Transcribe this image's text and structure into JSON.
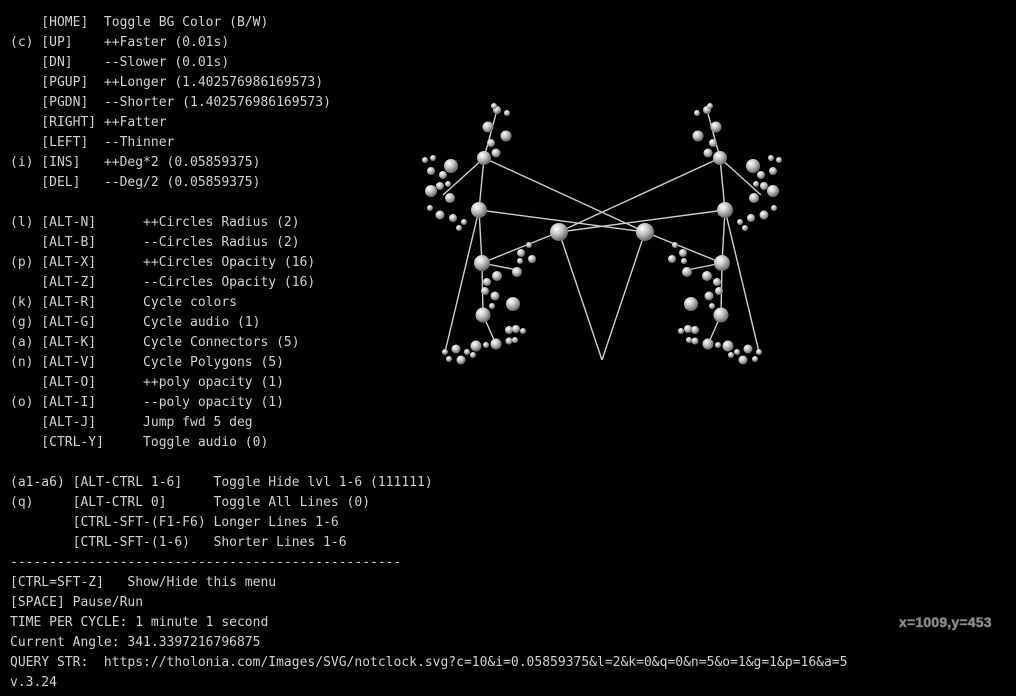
{
  "menu": {
    "lines": [
      "    [HOME]  Toggle BG Color (B/W)",
      "(c) [UP]    ++Faster (0.01s)",
      "    [DN]    --Slower (0.01s)",
      "    [PGUP]  ++Longer (1.402576986169573)",
      "    [PGDN]  --Shorter (1.402576986169573)",
      "    [RIGHT] ++Fatter",
      "    [LEFT]  --Thinner",
      "(i) [INS]   ++Deg*2 (0.05859375)",
      "    [DEL]   --Deg/2 (0.05859375)",
      "",
      "(l) [ALT-N]      ++Circles Radius (2)",
      "    [ALT-B]      --Circles Radius (2)",
      "(p) [ALT-X]      ++Circles Opacity (16)",
      "    [ALT-Z]      --Circles Opacity (16)",
      "(k) [ALT-R]      Cycle colors",
      "(g) [ALT-G]      Cycle audio (1)",
      "(a) [ALT-K]      Cycle Connectors (5)",
      "(n) [ALT-V]      Cycle Polygons (5)",
      "    [ALT-O]      ++poly opacity (1)",
      "(o) [ALT-I]      --poly opacity (1)",
      "    [ALT-J]      Jump fwd 5 deg",
      "    [CTRL-Y]     Toggle audio (0)",
      "",
      "(a1-a6) [ALT-CTRL 1-6]    Toggle Hide lvl 1-6 (111111)",
      "(q)     [ALT-CTRL 0]      Toggle All Lines (0)",
      "        [CTRL-SFT-(F1-F6) Longer Lines 1-6",
      "        [CTRL-SFT-(1-6)   Shorter Lines 1-6",
      "--------------------------------------------------",
      "[CTRL=SFT-Z]   Show/Hide this menu",
      "[SPACE] Pause/Run",
      "TIME PER CYCLE: 1 minute 1 second",
      "Current Angle: 341.3397216796875",
      "QUERY STR:  https://tholonia.com/Images/SVG/notclock.svg?c=10&i=0.05859375&l=2&k=0&q=0&n=5&o=1&g=1&p=16&a=5",
      "v.3.24"
    ]
  },
  "mouse": {
    "readout": "x=1009,y=453"
  },
  "colors": {
    "background": "#000000",
    "text": "#d2d2d2",
    "lines": "#cfcfcf",
    "spheres": "#bdbdbd"
  }
}
